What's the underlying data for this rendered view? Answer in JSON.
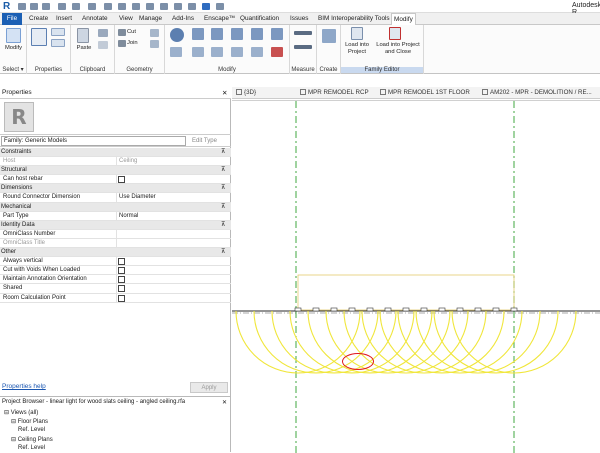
{
  "app": {
    "logo": "R",
    "title": "Autodesk R"
  },
  "tabs": [
    "File",
    "Create",
    "Insert",
    "Annotate",
    "View",
    "Manage",
    "Add-Ins",
    "Enscape™",
    "Quantification",
    "Issues",
    "BIM Interoperability Tools",
    "Modify"
  ],
  "active_tab": "Modify",
  "ribbon": {
    "modify_label": "Modify",
    "select_label": "Select",
    "select_caret": "▾",
    "panels": {
      "properties": "Properties",
      "clipboard": "Clipboard",
      "geometry": "Geometry",
      "modify": "Modify",
      "measure": "Measure",
      "create": "Create",
      "family_editor": "Family Editor"
    },
    "paste_label": "Paste",
    "cut_label": "Cut",
    "join_label": "Join",
    "load_into_project": "Load into Project",
    "load_into_project_close": "Load into Project and Close"
  },
  "properties_palette": {
    "title": "Properties",
    "close": "✕",
    "family_select": "Family: Generic Models",
    "edit_type": "Edit Type",
    "groups": [
      {
        "name": "Constraints",
        "rows": [
          {
            "key": "Host",
            "value": "Ceiling",
            "disabled": true
          }
        ]
      },
      {
        "name": "Structural",
        "rows": [
          {
            "key": "Can host rebar",
            "value": "",
            "checkbox": true
          }
        ]
      },
      {
        "name": "Dimensions",
        "rows": [
          {
            "key": "Round Connector Dimension",
            "value": "Use Diameter"
          }
        ]
      },
      {
        "name": "Mechanical",
        "rows": [
          {
            "key": "Part Type",
            "value": "Normal"
          }
        ]
      },
      {
        "name": "Identity Data",
        "rows": [
          {
            "key": "OmniClass Number",
            "value": ""
          },
          {
            "key": "OmniClass Title",
            "value": "",
            "disabled": true
          }
        ]
      },
      {
        "name": "Other",
        "rows": [
          {
            "key": "Always vertical",
            "value": "",
            "checkbox": true
          },
          {
            "key": "Cut with Voids When Loaded",
            "value": "",
            "checkbox": true
          },
          {
            "key": "Maintain Annotation Orientation",
            "value": "",
            "checkbox": true
          },
          {
            "key": "Shared",
            "value": "",
            "checkbox": true
          },
          {
            "key": "Room Calculation Point",
            "value": "",
            "checkbox": true
          }
        ]
      }
    ],
    "help_link": "Properties help",
    "apply": "Apply"
  },
  "project_browser": {
    "title": "Project Browser - linear light for wood slats ceiling - angled ceiling.rfa",
    "close": "✕",
    "items": [
      {
        "label": "Views (all)",
        "indent": 0,
        "toggle": "⊟"
      },
      {
        "label": "Floor Plans",
        "indent": 1,
        "toggle": "⊟"
      },
      {
        "label": "Ref. Level",
        "indent": 2,
        "toggle": ""
      },
      {
        "label": "Ceiling Plans",
        "indent": 1,
        "toggle": "⊟"
      },
      {
        "label": "Ref. Level",
        "indent": 2,
        "toggle": ""
      }
    ]
  },
  "view_tabs": [
    "{3D}",
    "MPR REMODEL RCP",
    "MPR REMODEL 1ST FLOOR",
    "AM202 - MPR - DEMOLITION / RE..."
  ],
  "colors": {
    "file_tab": "#1b5fb4",
    "annotation": "#e0161b",
    "light_arcs": "#f0e63a",
    "ref_plane": "#2e9e2e"
  }
}
